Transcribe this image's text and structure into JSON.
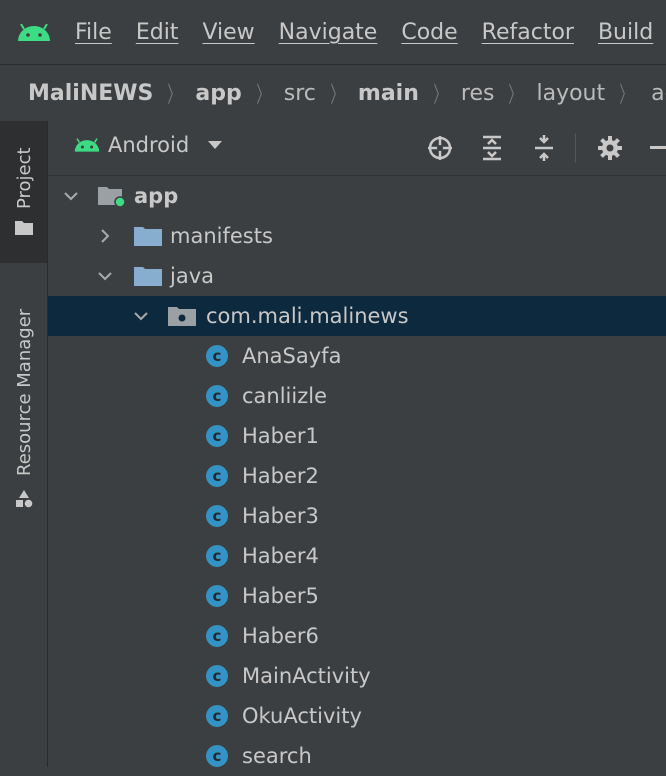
{
  "menubar": {
    "items": [
      "File",
      "Edit",
      "View",
      "Navigate",
      "Code",
      "Refactor",
      "Build"
    ]
  },
  "breadcrumb": {
    "items": [
      {
        "label": "MaliNEWS",
        "bold": true
      },
      {
        "label": "app",
        "bold": true
      },
      {
        "label": "src",
        "bold": false
      },
      {
        "label": "main",
        "bold": true
      },
      {
        "label": "res",
        "bold": false
      },
      {
        "label": "layout",
        "bold": false
      },
      {
        "label": "activity_",
        "bold": false
      }
    ]
  },
  "sidebar": {
    "project_tab": "Project",
    "resource_manager_tab": "Resource Manager"
  },
  "panel": {
    "view_mode": "Android"
  },
  "tree": {
    "app": "app",
    "manifests": "manifests",
    "java": "java",
    "package": "com.mali.malinews",
    "classes": [
      "AnaSayfa",
      "canliizle",
      "Haber1",
      "Haber2",
      "Haber3",
      "Haber4",
      "Haber5",
      "Haber6",
      "MainActivity",
      "OkuActivity",
      "search"
    ]
  },
  "colors": {
    "android_green": "#3ddc84",
    "folder_blue": "#87aecf",
    "class_icon": "#3592c4",
    "selection": "#0d293e"
  }
}
